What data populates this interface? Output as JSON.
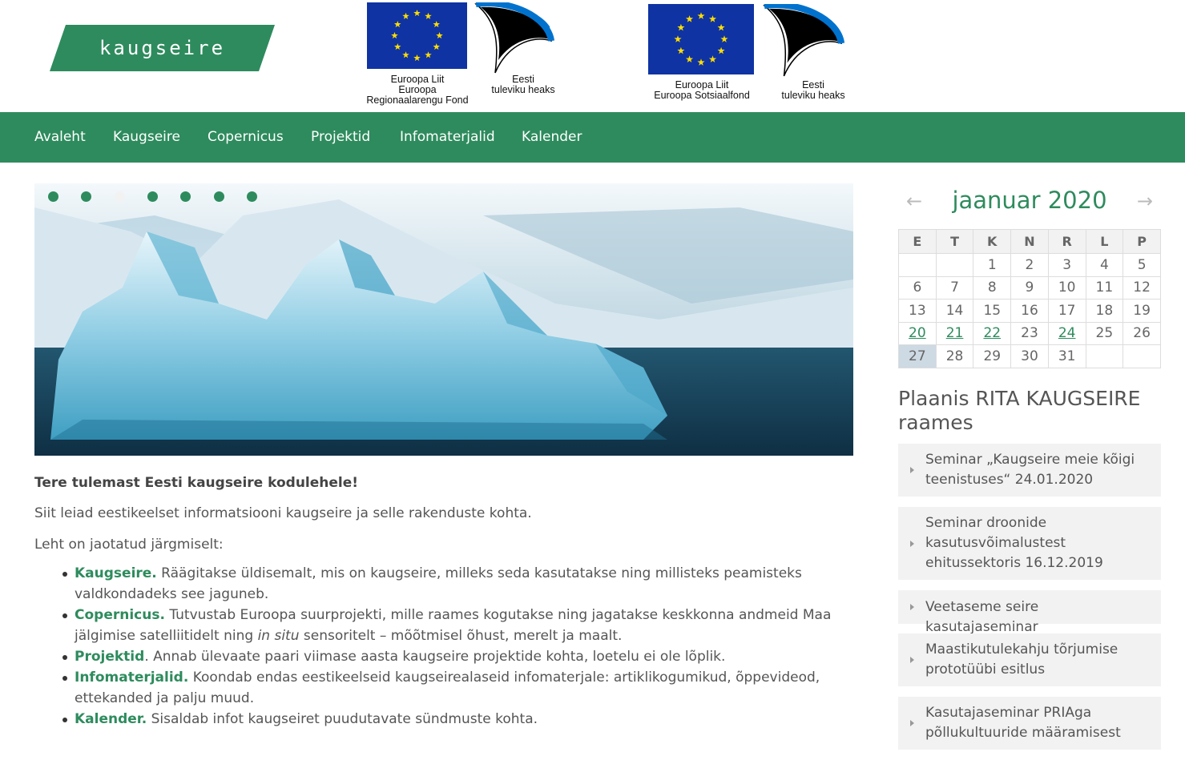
{
  "header": {
    "logo_text": "kaugseire",
    "fund1": {
      "caption": "Euroopa Liit\nEuroopa\nRegionaalarengu Fond",
      "ee_caption": "Eesti\ntuleviku heaks"
    },
    "fund2": {
      "caption": "Euroopa Liit\nEuroopa Sotsiaalfond",
      "ee_caption": "Eesti\ntuleviku heaks"
    }
  },
  "colors": {
    "brand_green": "#2e8b5d",
    "today_bg": "#cdd9e3"
  },
  "nav": {
    "items": [
      "Avaleht",
      "Kaugseire",
      "Copernicus",
      "Projektid",
      "Infomaterjalid",
      "Kalender"
    ]
  },
  "slider": {
    "dot_count": 7,
    "active_index": 2
  },
  "content": {
    "welcome": "Tere tulemast Eesti kaugseire kodulehele!",
    "intro": "Siit leiad eestikeelset informatsiooni kaugseire ja selle rakenduste kohta.",
    "sections_lead": "Leht on jaotatud järgmiselt:",
    "sections": [
      {
        "term": "Kaugseire.",
        "text": " Räägitakse üldisemalt, mis on kaugseire, milleks seda kasutatakse ning millisteks peamisteks valdkondadeks see jaguneb."
      },
      {
        "term": "Copernicus.",
        "text_before": " Tutvustab Euroopa suurprojekti, mille raames kogutakse ning jagatakse keskkonna andmeid Maa jälgimise satelliitidelt ning ",
        "em": "in situ",
        "text_after": " sensoritelt – mõõtmisel õhust, merelt ja maalt."
      },
      {
        "term": "Projektid",
        "text": ". Annab ülevaate paari viimase aasta kaugseire projektide kohta, loetelu ei ole lõplik."
      },
      {
        "term": "Infomaterjalid.",
        "text": " Koondab endas eestikeelseid kaugseirealaseid infomaterjale: artiklikogumikud, õppevideod, ettekanded ja palju muud."
      },
      {
        "term": "Kalender.",
        "text": " Sisaldab infot kaugseiret puudutavate sündmuste kohta."
      }
    ]
  },
  "calendar": {
    "title": "jaanuar 2020",
    "prev_icon": "arrow-left-icon",
    "next_icon": "arrow-right-icon",
    "weekdays": [
      "E",
      "T",
      "K",
      "N",
      "R",
      "L",
      "P"
    ],
    "weeks": [
      [
        "",
        "",
        "1",
        "2",
        "3",
        "4",
        "5"
      ],
      [
        "6",
        "7",
        "8",
        "9",
        "10",
        "11",
        "12"
      ],
      [
        "13",
        "14",
        "15",
        "16",
        "17",
        "18",
        "19"
      ],
      [
        "20",
        "21",
        "22",
        "23",
        "24",
        "25",
        "26"
      ],
      [
        "27",
        "28",
        "29",
        "30",
        "31",
        "",
        ""
      ]
    ],
    "linked_days": [
      "20",
      "21",
      "22",
      "24"
    ],
    "today": "27"
  },
  "planned": {
    "title": "Plaanis RITA KAUGSEIRE raames",
    "events": [
      "Seminar „Kaugseire meie kõigi teenistuses“ 24.01.2020",
      "Seminar droonide kasutusvõimalustest ehitussektoris 16.12.2019",
      "Veetaseme seire kasutajaseminar",
      "Maastikutulekahju tõrjumise prototüübi esitlus",
      "Kasutajaseminar PRIAga põllukultuuride määramisest"
    ]
  }
}
